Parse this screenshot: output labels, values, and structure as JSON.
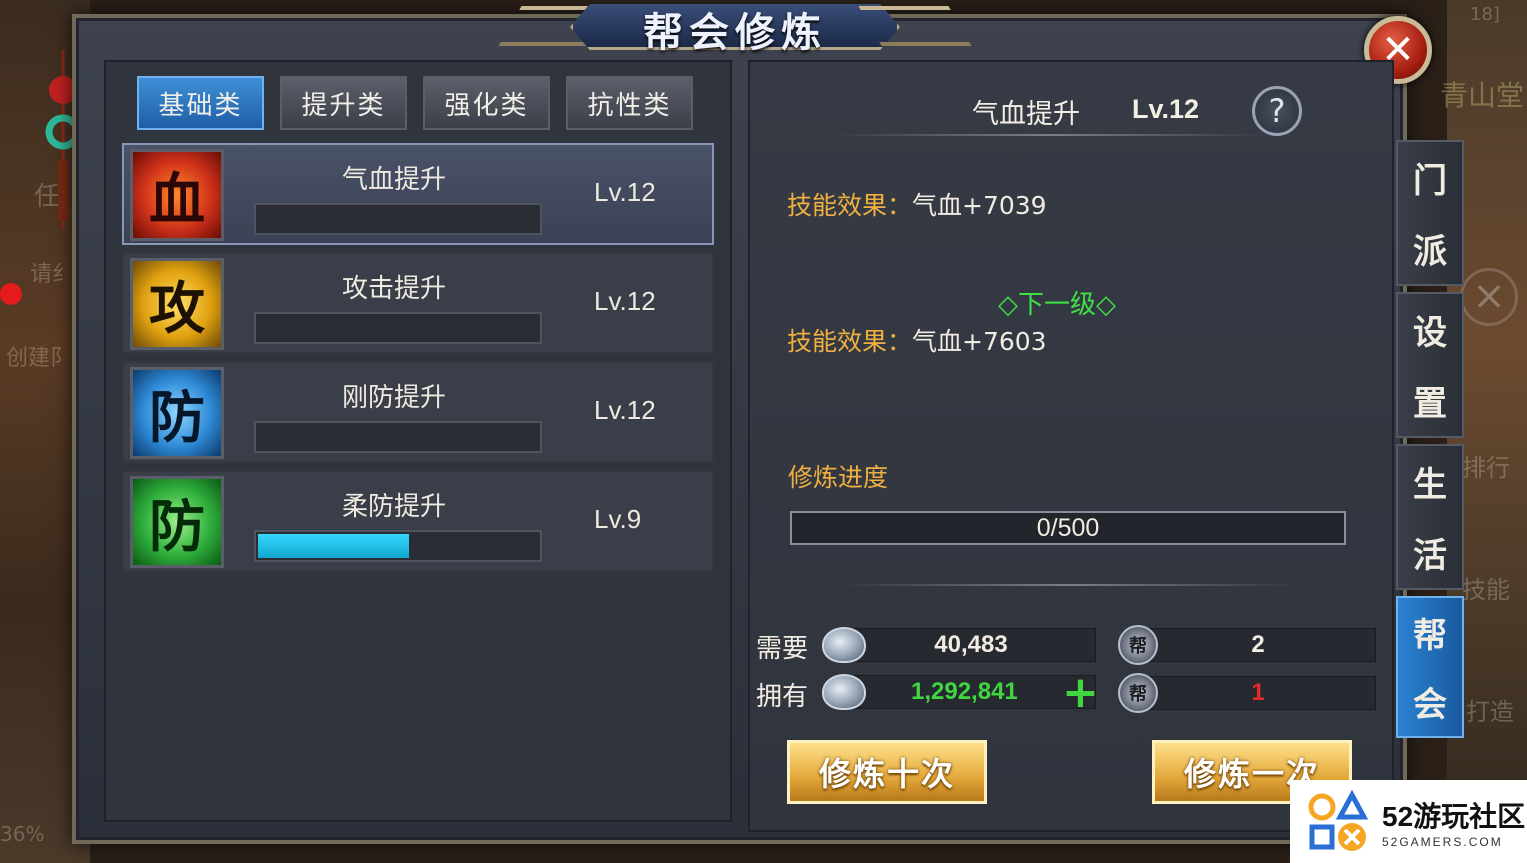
{
  "window": {
    "title": "帮会修炼",
    "close_glyph": "✕"
  },
  "background": {
    "ghost_left_1": "任",
    "ghost_left_2": "请纟",
    "ghost_left_3": "创建阝",
    "ghost_left_4": "36%",
    "ghost_right_1": "青山堂",
    "ghost_right_2": "排行",
    "ghost_right_3": "技能",
    "ghost_right_4": "打造",
    "ghost_right_top": "18]"
  },
  "tabs": [
    {
      "label": "基础类",
      "active": true
    },
    {
      "label": "提升类",
      "active": false
    },
    {
      "label": "强化类",
      "active": false
    },
    {
      "label": "抗性类",
      "active": false
    }
  ],
  "skills": [
    {
      "icon_char": "血",
      "icon": "blood-icon",
      "name": "气血提升",
      "level": "Lv.12",
      "progress": 0,
      "selected": true
    },
    {
      "icon_char": "攻",
      "icon": "attack-icon",
      "name": "攻击提升",
      "level": "Lv.12",
      "progress": 0,
      "selected": false
    },
    {
      "icon_char": "防",
      "icon": "hard-defense-icon",
      "name": "刚防提升",
      "level": "Lv.12",
      "progress": 0,
      "selected": false
    },
    {
      "icon_char": "防",
      "icon": "soft-defense-icon",
      "name": "柔防提升",
      "level": "Lv.9",
      "progress": 0.53,
      "selected": false
    }
  ],
  "detail": {
    "skill_name": "气血提升",
    "skill_level": "Lv.12",
    "help_glyph": "?",
    "effect_label": "技能效果：",
    "effect_value": "气血+7039",
    "next_level_label": "◇下一级◇",
    "next_effect_label": "技能效果：",
    "next_effect_value": "气血+7603",
    "progress_label": "修炼进度",
    "progress_text": "0/500",
    "progress_value": 0,
    "progress_max": 500
  },
  "cost": {
    "need_label": "需要",
    "have_label": "拥有",
    "need_silver": "40,483",
    "have_silver": "1,292,841",
    "need_token": "2",
    "have_token": "1",
    "plus_glyph": "+",
    "token_glyph": "帮"
  },
  "actions": {
    "train_ten": "修炼十次",
    "train_once": "修炼一次"
  },
  "side_tabs": [
    {
      "chars": [
        "门",
        "派"
      ],
      "active": false
    },
    {
      "chars": [
        "设",
        "置"
      ],
      "active": false
    },
    {
      "chars": [
        "生",
        "活"
      ],
      "active": false
    },
    {
      "chars": [
        "帮",
        "会"
      ],
      "active": true
    }
  ],
  "watermark": {
    "main": "52游玩社区",
    "sub": "52GAMERS.COM"
  },
  "colors": {
    "accent_blue": "#1f5ea6",
    "label_orange": "#f0b040",
    "next_green": "#3fe045",
    "have_green": "#3fd63f",
    "lacking_red": "#e52a2a",
    "progress_cyan": "#37d6ff"
  }
}
